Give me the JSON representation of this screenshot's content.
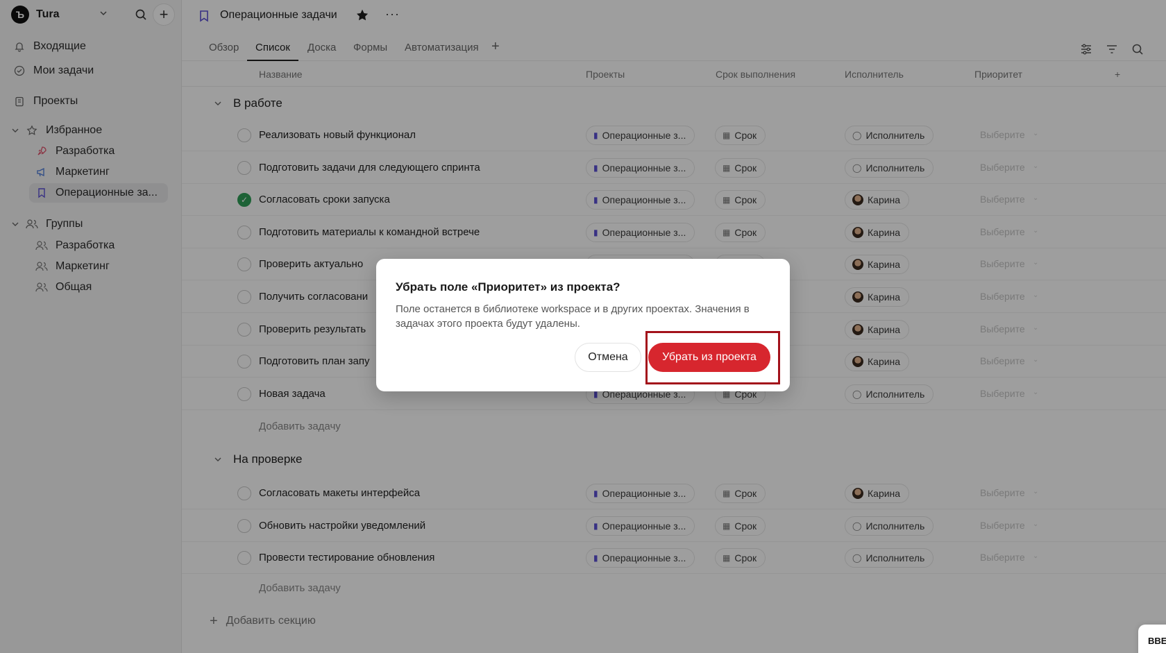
{
  "workspace": {
    "name": "Tura",
    "logo_letter": "Ъ"
  },
  "sidebar": {
    "inbox": "Входящие",
    "my_tasks": "Мои задачи",
    "projects": "Проекты",
    "favorites": {
      "label": "Избранное",
      "items": [
        "Разработка",
        "Маркетинг",
        "Операционные за..."
      ]
    },
    "groups": {
      "label": "Группы",
      "items": [
        "Разработка",
        "Маркетинг",
        "Общая"
      ]
    }
  },
  "header": {
    "title": "Операционные задачи",
    "more": "···"
  },
  "tabs": [
    "Обзор",
    "Список",
    "Доска",
    "Формы",
    "Автоматизация"
  ],
  "active_tab": "Список",
  "columns": {
    "name": "Название",
    "projects": "Проекты",
    "due": "Срок выполнения",
    "assignee": "Исполнитель",
    "priority": "Приоритет"
  },
  "cell_defaults": {
    "project": "Операционные з...",
    "due": "Срок",
    "assignee_empty": "Исполнитель",
    "priority": "Выберите"
  },
  "sections": [
    {
      "title": "В работе",
      "tasks": [
        {
          "name": "Реализовать новый функционал",
          "done": false,
          "assignee": "Исполнитель"
        },
        {
          "name": "Подготовить задачи для следующего спринта",
          "done": false,
          "assignee": "Исполнитель"
        },
        {
          "name": "Согласовать сроки запуска",
          "done": true,
          "assignee": "Карина"
        },
        {
          "name": "Подготовить материалы к командной встрече",
          "done": false,
          "assignee": "Карина"
        },
        {
          "name": "Проверить актуально",
          "done": false,
          "assignee": "Карина"
        },
        {
          "name": "Получить согласовани",
          "done": false,
          "assignee": "Карина"
        },
        {
          "name": "Проверить результать",
          "done": false,
          "assignee": "Карина"
        },
        {
          "name": "Подготовить план запу",
          "done": false,
          "assignee": "Карина"
        },
        {
          "name": "Новая задача",
          "done": false,
          "assignee": "Исполнитель"
        }
      ],
      "add_task": "Добавить задачу"
    },
    {
      "title": "На проверке",
      "tasks": [
        {
          "name": "Согласовать макеты интерфейса",
          "done": false,
          "assignee": "Карина"
        },
        {
          "name": "Обновить настройки уведомлений",
          "done": false,
          "assignee": "Исполнитель"
        },
        {
          "name": "Провести тестирование обновления",
          "done": false,
          "assignee": "Исполнитель"
        }
      ],
      "add_task": "Добавить задачу"
    }
  ],
  "add_section": "Добавить секцию",
  "dialog": {
    "title": "Убрать поле «Приоритет» из проекта?",
    "body": "Поле останется в библиотеке workspace и в других проектах. Значения в задачах этого проекта будут удалены.",
    "cancel": "Отмена",
    "confirm": "Убрать из проекта"
  },
  "corner_chip": "ВВЕ",
  "colors": {
    "accent": "#5b4fd6",
    "danger": "#d7262e",
    "highlight": "#a3121b",
    "done": "#2f9e57"
  }
}
